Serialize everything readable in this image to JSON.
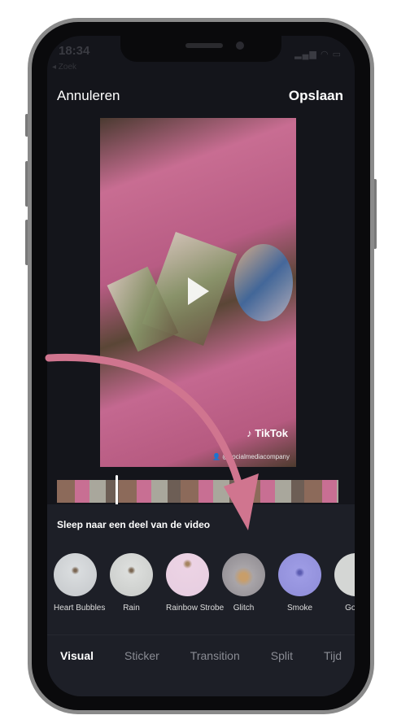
{
  "status_bar": {
    "time": "18:34",
    "back_label": "◂ Zoek"
  },
  "header": {
    "cancel_label": "Annuleren",
    "save_label": "Opslaan"
  },
  "video": {
    "watermark": "TikTok",
    "handle": "@socialmediacompany"
  },
  "panel": {
    "hint": "Sleep naar een deel van de video",
    "effects": [
      {
        "label": "Heart Bubbles",
        "color": "#d9dcde"
      },
      {
        "label": "Rain",
        "color": "#dcdedc"
      },
      {
        "label": "Rainbow Strobe",
        "color": "#ecd3e4"
      },
      {
        "label": "Glitch",
        "color": "#a8a4a8"
      },
      {
        "label": "Smoke",
        "color": "#9d9be4"
      },
      {
        "label": "Gold I",
        "color": "#d4d6d4"
      }
    ],
    "tabs": [
      {
        "label": "Visual",
        "active": true
      },
      {
        "label": "Sticker"
      },
      {
        "label": "Transition"
      },
      {
        "label": "Split"
      },
      {
        "label": "Tijd"
      }
    ]
  },
  "colors": {
    "annotation_arrow": "#d0758f",
    "background": "#14151b"
  }
}
